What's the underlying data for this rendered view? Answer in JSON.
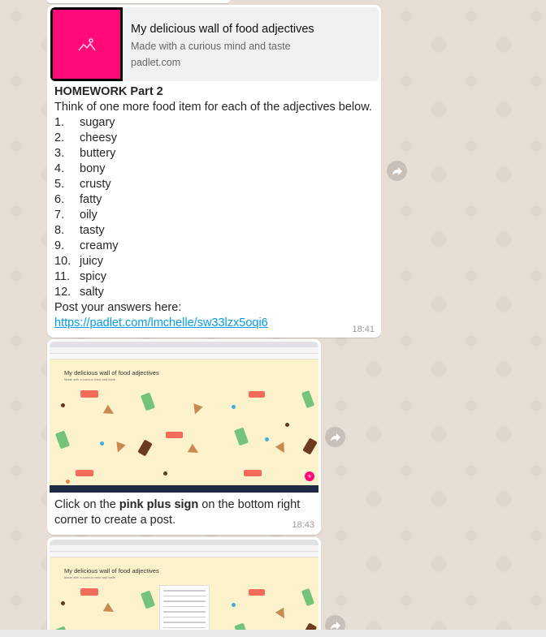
{
  "link_preview": {
    "title": "My delicious wall of food adjectives",
    "description": "Made with a curious mind and taste",
    "domain": "padlet.com",
    "thumbnail_color": "#ff0a78",
    "thumbnail_icon": "image-placeholder-icon"
  },
  "homework": {
    "title": "HOMEWORK Part 2",
    "instruction": "Think of one more food item for each of the adjectives below.",
    "items": [
      {
        "num": "1.",
        "word": "sugary"
      },
      {
        "num": "2.",
        "word": "cheesy"
      },
      {
        "num": "3.",
        "word": "buttery"
      },
      {
        "num": "4.",
        "word": "bony"
      },
      {
        "num": "5.",
        "word": "crusty"
      },
      {
        "num": "6.",
        "word": "fatty"
      },
      {
        "num": "7.",
        "word": "oily"
      },
      {
        "num": "8.",
        "word": "tasty"
      },
      {
        "num": "9.",
        "word": "creamy"
      },
      {
        "num": "10.",
        "word": "juicy"
      },
      {
        "num": "11.",
        "word": "spicy"
      },
      {
        "num": "12.",
        "word": "salty"
      }
    ],
    "post_prompt": "Post your answers here:",
    "link": "https://padlet.com/lmchelle/sw33lzx5oqi6",
    "time": "18:41"
  },
  "screenshot_message": {
    "screenshot_title": "My delicious wall of food adjectives",
    "screenshot_subtitle": "Made with a curious mind and taste",
    "caption_before": "Click on the ",
    "caption_bold": "pink plus sign",
    "caption_after": " on the bottom right corner to create a post.",
    "time": "18:43"
  },
  "screenshot_message_2": {
    "screenshot_title": "My delicious wall of food adjectives",
    "screenshot_subtitle": "Made with a curious mind and taste"
  },
  "icons": {
    "forward": "forward-icon"
  },
  "colors": {
    "link": "#039be5",
    "accent_pink": "#ff0a78",
    "background": "#e5ddd5"
  }
}
